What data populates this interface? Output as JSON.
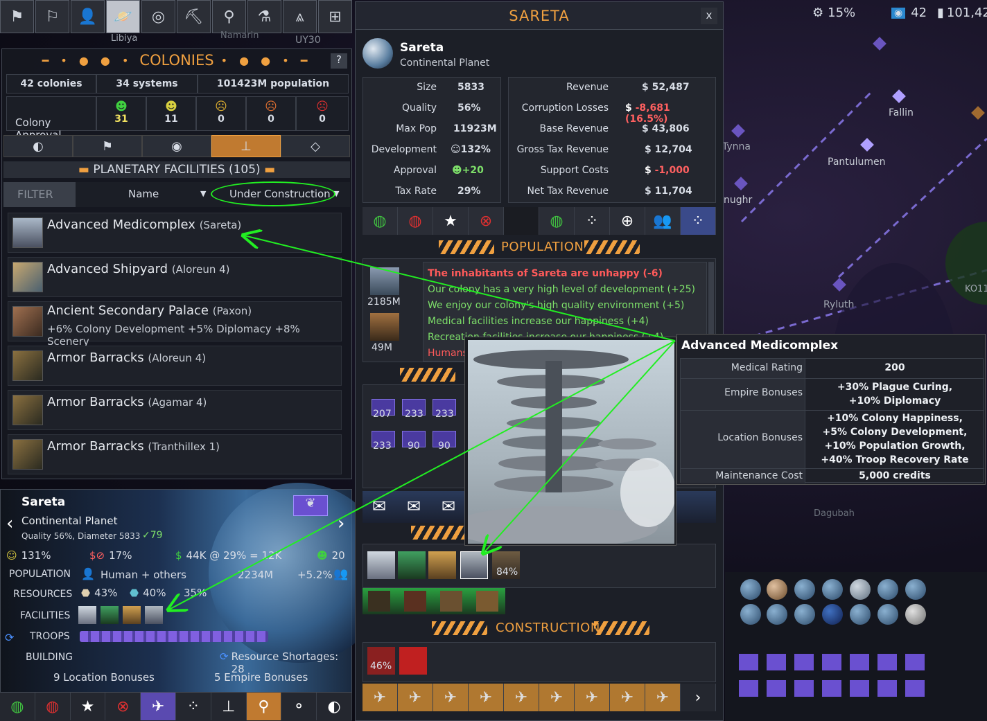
{
  "top_icons": [
    "empire-flag",
    "diplomacy",
    "characters",
    "colonies",
    "galaxy-map",
    "research",
    "leaders",
    "laboratory",
    "military",
    "ships"
  ],
  "top_stats": {
    "corruption": "15%",
    "colonies_count": "42",
    "credits": "101,42"
  },
  "map_labels": [
    "Libiya",
    "Namarin",
    "UY30",
    "Fallin",
    "Tynna",
    "Pantulumen",
    "nughr",
    "Ryluth",
    "Dagubah",
    "KO11"
  ],
  "colonies": {
    "title": "COLONIES",
    "help": "?",
    "summary": {
      "colonies": "42 colonies",
      "systems": "34 systems",
      "population": "101423M population"
    },
    "approval_label": "Colony Approval",
    "approval_counts": [
      "31",
      "11",
      "0",
      "0",
      "0"
    ],
    "section_title": "PLANETARY FACILITIES (105)",
    "filter_label": "FILTER",
    "sort_by": "Name",
    "filter_value": "Under Construction",
    "facilities": [
      {
        "name": "Advanced Medicomplex",
        "loc": "(Sareta)",
        "sub": ""
      },
      {
        "name": "Advanced Shipyard",
        "loc": "(Aloreun 4)",
        "sub": ""
      },
      {
        "name": "Ancient Secondary Palace",
        "loc": "(Paxon)",
        "sub": "+6% Colony Development  +5% Diplomacy  +8% Scenery"
      },
      {
        "name": "Armor Barracks",
        "loc": "(Aloreun 4)",
        "sub": ""
      },
      {
        "name": "Armor Barracks",
        "loc": "(Agamar 4)",
        "sub": ""
      },
      {
        "name": "Armor Barracks",
        "loc": "(Tranthillex 1)",
        "sub": ""
      }
    ]
  },
  "colony_card": {
    "name": "Sareta",
    "type": "Continental Planet",
    "quality": "Quality 56%, Diameter 5833",
    "troop_readiness": "79",
    "development": "131%",
    "corruption": "17%",
    "tax_line": "44K @ 29% = 12K",
    "approval": "20",
    "population_label": "POPULATION",
    "population_species": "Human + others",
    "population_value": "2234M",
    "population_growth": "+5.2%",
    "resources_label": "RESOURCES",
    "resources": [
      "43%",
      "40%",
      "35%"
    ],
    "facilities_label": "FACILITIES",
    "troops_label": "TROOPS",
    "building_label": "BUILDING",
    "shortages": "Resource Shortages: 28",
    "location_bonuses": "9 Location Bonuses",
    "empire_bonuses": "5 Empire Bonuses"
  },
  "planet_window": {
    "title": "SARETA",
    "close": "x",
    "name": "Sareta",
    "type": "Continental Planet",
    "left_stats": [
      {
        "k": "Size",
        "v": "5833"
      },
      {
        "k": "Quality",
        "v": "56%"
      },
      {
        "k": "Max Pop",
        "v": "11923M"
      },
      {
        "k": "Development",
        "v": "132%"
      },
      {
        "k": "Approval",
        "v": "+20"
      },
      {
        "k": "Tax Rate",
        "v": "29%"
      }
    ],
    "right_stats": [
      {
        "k": "Revenue",
        "v": "52,487"
      },
      {
        "k": "Corruption Losses",
        "v": "-8,681 (16.5%)"
      },
      {
        "k": "Base Revenue",
        "v": "43,806"
      },
      {
        "k": "Gross Tax Revenue",
        "v": "12,704"
      },
      {
        "k": "Support Costs",
        "v": "-1,000"
      },
      {
        "k": "Net Tax Revenue",
        "v": "11,704"
      }
    ],
    "population_title": "POPULATION",
    "pop_values": [
      "2185M",
      "49M"
    ],
    "messages": [
      {
        "text": "The inhabitants of Sareta are unhappy (-6)",
        "color": "red"
      },
      {
        "text": "Our colony has a very high level of development (+25)",
        "color": "green"
      },
      {
        "text": "We enjoy our colony's high quality environment (+5)",
        "color": "green"
      },
      {
        "text": "Medical facilities increase our happiness (+4)",
        "color": "green"
      },
      {
        "text": "Recreation facilities increase our happiness (+4)",
        "color": "green"
      },
      {
        "text": "Humans",
        "color": "red"
      }
    ],
    "troop_values": [
      "207",
      "233",
      "233",
      "233",
      "90",
      "90"
    ],
    "facility_progress": "84%",
    "construction_title": "CONSTRUCTION",
    "construction_progress": "46%"
  },
  "tooltip": {
    "title": "Advanced Medicomplex",
    "rows": [
      {
        "k": "Medical Rating",
        "v": "200"
      },
      {
        "k": "Empire Bonuses",
        "v": "+30% Plague Curing,\n+10% Diplomacy"
      },
      {
        "k": "Location Bonuses",
        "v": "+10% Colony Happiness,\n+5% Colony Development,\n+10% Population Growth,\n+40% Troop Recovery Rate"
      },
      {
        "k": "Maintenance Cost",
        "v": "5,000 credits"
      }
    ]
  },
  "colors": {
    "accent": "#f0a040",
    "annotation": "#22ee22",
    "positive": "#7ee06a",
    "negative": "#ff5a5a"
  }
}
